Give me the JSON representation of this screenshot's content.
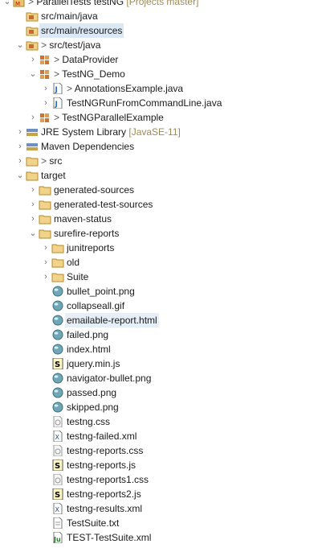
{
  "tree": [
    {
      "depth": 0,
      "tw": "open",
      "icon": "project-icon",
      "pre": "> ",
      "label": "ParallelTests testNG",
      "suffix": " [Projects master]"
    },
    {
      "depth": 1,
      "tw": "",
      "icon": "source-folder-icon",
      "pre": "",
      "label": "src/main/java",
      "suffix": ""
    },
    {
      "depth": 1,
      "tw": "",
      "icon": "source-folder-icon",
      "pre": "",
      "label": "src/main/resources",
      "suffix": "",
      "sel": true
    },
    {
      "depth": 1,
      "tw": "open",
      "icon": "source-folder-icon",
      "pre": "> ",
      "label": "src/test/java",
      "suffix": ""
    },
    {
      "depth": 2,
      "tw": "closed",
      "icon": "package-icon",
      "pre": "> ",
      "label": "DataProvider",
      "suffix": ""
    },
    {
      "depth": 2,
      "tw": "open",
      "icon": "package-icon",
      "pre": "> ",
      "label": "TestNG_Demo",
      "suffix": ""
    },
    {
      "depth": 3,
      "tw": "closed",
      "icon": "java-file-icon",
      "pre": "> ",
      "label": "AnnotationsExample.java",
      "suffix": ""
    },
    {
      "depth": 3,
      "tw": "closed",
      "icon": "java-file-icon",
      "pre": "",
      "label": "TestNGRunFromCommandLine.java",
      "suffix": ""
    },
    {
      "depth": 2,
      "tw": "closed",
      "icon": "package-icon",
      "pre": "> ",
      "label": "TestNGParallelExample",
      "suffix": ""
    },
    {
      "depth": 1,
      "tw": "closed",
      "icon": "library-icon",
      "pre": "",
      "label": "JRE System Library",
      "suffix": " [JavaSE-11]"
    },
    {
      "depth": 1,
      "tw": "closed",
      "icon": "library-icon",
      "pre": "",
      "label": "Maven Dependencies",
      "suffix": ""
    },
    {
      "depth": 1,
      "tw": "closed",
      "icon": "folder-icon",
      "pre": "> ",
      "label": "src",
      "suffix": ""
    },
    {
      "depth": 1,
      "tw": "open",
      "icon": "folder-icon",
      "pre": "",
      "label": "target",
      "suffix": ""
    },
    {
      "depth": 2,
      "tw": "closed",
      "icon": "folder-icon",
      "pre": "",
      "label": "generated-sources",
      "suffix": ""
    },
    {
      "depth": 2,
      "tw": "closed",
      "icon": "folder-icon",
      "pre": "",
      "label": "generated-test-sources",
      "suffix": ""
    },
    {
      "depth": 2,
      "tw": "closed",
      "icon": "folder-icon",
      "pre": "",
      "label": "maven-status",
      "suffix": ""
    },
    {
      "depth": 2,
      "tw": "open",
      "icon": "folder-icon",
      "pre": "",
      "label": "surefire-reports",
      "suffix": ""
    },
    {
      "depth": 3,
      "tw": "closed",
      "icon": "folder-icon",
      "pre": "",
      "label": "junitreports",
      "suffix": ""
    },
    {
      "depth": 3,
      "tw": "closed",
      "icon": "folder-icon",
      "pre": "",
      "label": "old",
      "suffix": ""
    },
    {
      "depth": 3,
      "tw": "closed",
      "icon": "folder-icon",
      "pre": "",
      "label": "Suite",
      "suffix": ""
    },
    {
      "depth": 3,
      "tw": "",
      "icon": "image-file-icon",
      "pre": "",
      "label": "bullet_point.png",
      "suffix": ""
    },
    {
      "depth": 3,
      "tw": "",
      "icon": "image-file-icon",
      "pre": "",
      "label": "collapseall.gif",
      "suffix": ""
    },
    {
      "depth": 3,
      "tw": "",
      "icon": "html-file-icon",
      "pre": "",
      "label": "emailable-report.html",
      "suffix": "",
      "sel2": true
    },
    {
      "depth": 3,
      "tw": "",
      "icon": "image-file-icon",
      "pre": "",
      "label": "failed.png",
      "suffix": ""
    },
    {
      "depth": 3,
      "tw": "",
      "icon": "html-file-icon",
      "pre": "",
      "label": "index.html",
      "suffix": ""
    },
    {
      "depth": 3,
      "tw": "",
      "icon": "js-file-icon",
      "pre": "",
      "label": "jquery.min.js",
      "suffix": ""
    },
    {
      "depth": 3,
      "tw": "",
      "icon": "image-file-icon",
      "pre": "",
      "label": "navigator-bullet.png",
      "suffix": ""
    },
    {
      "depth": 3,
      "tw": "",
      "icon": "image-file-icon",
      "pre": "",
      "label": "passed.png",
      "suffix": ""
    },
    {
      "depth": 3,
      "tw": "",
      "icon": "image-file-icon",
      "pre": "",
      "label": "skipped.png",
      "suffix": ""
    },
    {
      "depth": 3,
      "tw": "",
      "icon": "css-file-icon",
      "pre": "",
      "label": "testng.css",
      "suffix": ""
    },
    {
      "depth": 3,
      "tw": "",
      "icon": "xml-file-icon",
      "pre": "",
      "label": "testng-failed.xml",
      "suffix": ""
    },
    {
      "depth": 3,
      "tw": "",
      "icon": "css-file-icon",
      "pre": "",
      "label": "testng-reports.css",
      "suffix": ""
    },
    {
      "depth": 3,
      "tw": "",
      "icon": "js-file-icon",
      "pre": "",
      "label": "testng-reports.js",
      "suffix": ""
    },
    {
      "depth": 3,
      "tw": "",
      "icon": "css-file-icon",
      "pre": "",
      "label": "testng-reports1.css",
      "suffix": ""
    },
    {
      "depth": 3,
      "tw": "",
      "icon": "js-file-icon",
      "pre": "",
      "label": "testng-reports2.js",
      "suffix": ""
    },
    {
      "depth": 3,
      "tw": "",
      "icon": "xml-file-icon",
      "pre": "",
      "label": "testng-results.xml",
      "suffix": ""
    },
    {
      "depth": 3,
      "tw": "",
      "icon": "text-file-icon",
      "pre": "",
      "label": "TestSuite.txt",
      "suffix": ""
    },
    {
      "depth": 3,
      "tw": "",
      "icon": "junit-xml-file-icon",
      "pre": "",
      "label": "TEST-TestSuite.xml",
      "suffix": ""
    }
  ]
}
